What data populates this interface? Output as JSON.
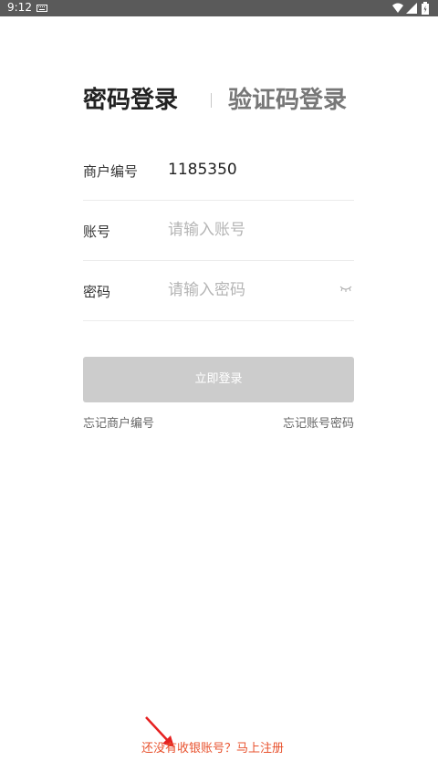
{
  "status_bar": {
    "time": "9:12",
    "icons": [
      "keyboard-icon",
      "wifi-icon",
      "signal-icon",
      "battery-icon"
    ]
  },
  "tabs": [
    {
      "label": "密码登录",
      "active": true
    },
    {
      "label": "验证码登录",
      "active": false
    }
  ],
  "form": {
    "merchant": {
      "label": "商户编号",
      "value": "1185350"
    },
    "account": {
      "label": "账号",
      "placeholder": "请输入账号",
      "value": ""
    },
    "password": {
      "label": "密码",
      "placeholder": "请输入密码",
      "value": ""
    }
  },
  "login_button": {
    "label": "立即登录"
  },
  "links": {
    "forgot_merchant": "忘记商户编号",
    "forgot_password": "忘记账号密码"
  },
  "register": {
    "text": "还没有收银账号？马上注册"
  },
  "colors": {
    "status_bar": "#5a5a5a",
    "button_disabled": "#cccccc",
    "accent": "#e8532f",
    "placeholder": "#b5b5b5",
    "divider": "#ececec"
  }
}
